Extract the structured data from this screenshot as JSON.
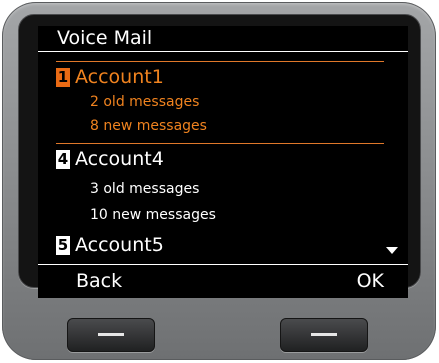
{
  "screen": {
    "title": "Voice Mail",
    "accounts": [
      {
        "number": "1",
        "name": "Account1",
        "old": "2 old messages",
        "new": "8 new messages",
        "selected": true
      },
      {
        "number": "4",
        "name": "Account4",
        "old": "3 old messages",
        "new": "10 new messages",
        "selected": false
      },
      {
        "number": "5",
        "name": "Account5",
        "selected": false
      }
    ],
    "scroll_indicator": "down-arrow-icon",
    "softkeys": {
      "left": "Back",
      "right": "OK"
    }
  },
  "hardware_buttons": {
    "left": "left-softkey-button",
    "right": "right-softkey-button"
  },
  "colors": {
    "accent": "#f0831f",
    "screen_bg": "#000000",
    "text": "#ffffff"
  }
}
